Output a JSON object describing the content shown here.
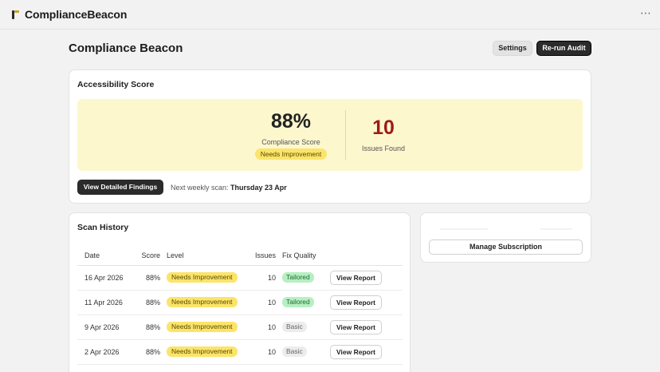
{
  "app": {
    "title": "ComplianceBeacon",
    "logo_icon": "beacon-logo-icon",
    "more_icon": "more-dots-icon"
  },
  "header": {
    "title": "Compliance Beacon",
    "settings_label": "Settings",
    "rerun_label": "Re-run Audit"
  },
  "score_card": {
    "title": "Accessibility Score",
    "score": "88%",
    "score_label": "Compliance Score",
    "level": "Needs Improvement",
    "issues": "10",
    "issues_label": "Issues Found",
    "findings_label": "View Detailed Findings",
    "next_scan_prefix": "Next weekly scan:",
    "next_scan_date": "Thursday 23 Apr",
    "colors": {
      "panel": "#fdf7ce",
      "issues": "#9b1c1c",
      "level_badge": "#fbe46a"
    }
  },
  "subscription": {
    "manage_label": "Manage Subscription"
  },
  "history": {
    "title": "Scan History",
    "columns": [
      "Date",
      "Score",
      "Level",
      "Issues",
      "Fix Quality"
    ],
    "action_label": "View Report",
    "rows": [
      {
        "date": "16 Apr 2026",
        "score": "88%",
        "level": "Needs Improvement",
        "issues": "10",
        "quality": "Tailored"
      },
      {
        "date": "11 Apr 2026",
        "score": "88%",
        "level": "Needs Improvement",
        "issues": "10",
        "quality": "Tailored"
      },
      {
        "date": "9 Apr 2026",
        "score": "88%",
        "level": "Needs Improvement",
        "issues": "10",
        "quality": "Basic"
      },
      {
        "date": "2 Apr 2026",
        "score": "88%",
        "level": "Needs Improvement",
        "issues": "10",
        "quality": "Basic"
      }
    ]
  }
}
